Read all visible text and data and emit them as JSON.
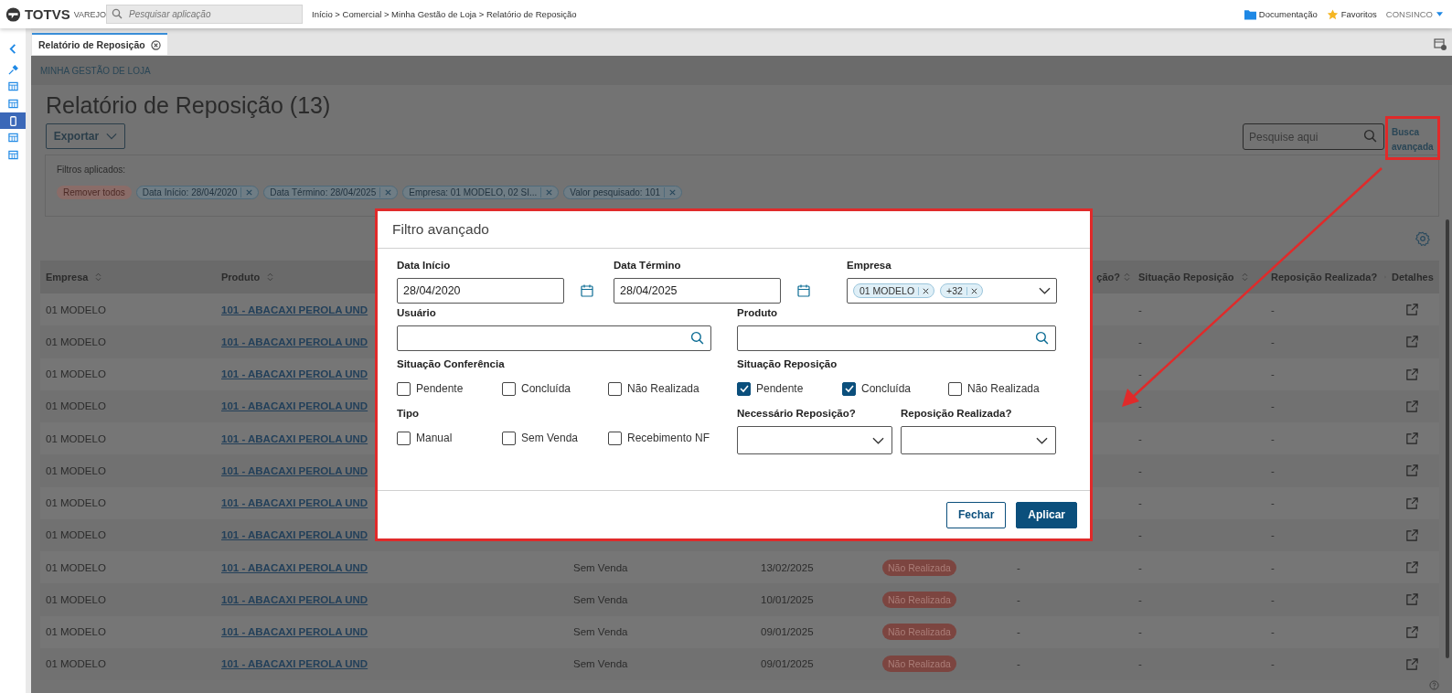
{
  "top_bar": {
    "brand": "TOTVS",
    "brand_sub": "VAREJO",
    "search": {
      "placeholder": "Pesquisar aplicação"
    },
    "breadcrumb": "Início > Comercial > Minha Gestão de Loja > Relatório de Reposição",
    "links": [
      {
        "label": "Documentação",
        "kind": "folder"
      },
      {
        "label": "Favoritos",
        "kind": "star"
      }
    ],
    "user": "CONSINCO"
  },
  "sidebar": {
    "items": [
      {
        "kind": "collapse",
        "selected": false
      },
      {
        "kind": "pin",
        "selected": false
      },
      {
        "kind": "grid",
        "selected": false
      },
      {
        "kind": "grid",
        "selected": false
      },
      {
        "kind": "phone",
        "selected": true
      },
      {
        "kind": "grid",
        "selected": false
      },
      {
        "kind": "grid",
        "selected": false
      }
    ]
  },
  "tabs": [
    {
      "label": "Relatório de Reposição",
      "selected": true
    }
  ],
  "page": {
    "section": "MINHA GESTÃO DE LOJA",
    "title": "Relatório de Reposição (13)",
    "export_button": "Exportar",
    "search": {
      "placeholder": "Pesquise aqui"
    },
    "advanced_search": "Busca avançada"
  },
  "filters": {
    "label": "Filtros aplicados:",
    "remove_all": "Remover todos",
    "chips": [
      "Data Início: 28/04/2020",
      "Data Término: 28/04/2025",
      "Empresa: 01 MODELO, 02 SI...",
      "Valor pesquisado: 101"
    ]
  },
  "table": {
    "columns": [
      {
        "label": "Empresa",
        "sortable": true
      },
      {
        "label": "Produto",
        "sortable": true
      },
      {
        "label": "ção?",
        "sortable": true
      },
      {
        "label": "Situação Reposição",
        "sortable": true
      },
      {
        "label": "Reposição Realizada?",
        "sortable": true
      },
      {
        "label": "Detalhes",
        "sortable": false
      }
    ],
    "rows": [
      {
        "empresa": "01 MODELO",
        "produto": "101 - ABACAXI PEROLA UND",
        "situacao_reposicao": "-",
        "reposicao_realizada": "-"
      },
      {
        "empresa": "01 MODELO",
        "produto": "101 - ABACAXI PEROLA UND",
        "situacao_reposicao": "-",
        "reposicao_realizada": "-"
      },
      {
        "empresa": "01 MODELO",
        "produto": "101 - ABACAXI PEROLA UND",
        "situacao_reposicao": "-",
        "reposicao_realizada": "-"
      },
      {
        "empresa": "01 MODELO",
        "produto": "101 - ABACAXI PEROLA UND",
        "situacao_reposicao": "-",
        "reposicao_realizada": "-"
      },
      {
        "empresa": "01 MODELO",
        "produto": "101 - ABACAXI PEROLA UND",
        "situacao_reposicao": "-",
        "reposicao_realizada": "-"
      },
      {
        "empresa": "01 MODELO",
        "produto": "101 - ABACAXI PEROLA UND",
        "situacao_reposicao": "-",
        "reposicao_realizada": "-"
      },
      {
        "empresa": "01 MODELO",
        "produto": "101 - ABACAXI PEROLA UND",
        "situacao_reposicao": "-",
        "reposicao_realizada": "-"
      },
      {
        "empresa": "01 MODELO",
        "produto": "101 - ABACAXI PEROLA UND",
        "situacao_reposicao": "-",
        "reposicao_realizada": "-"
      },
      {
        "empresa": "01 MODELO",
        "produto": "101 - ABACAXI PEROLA UND",
        "tipo": "Sem Venda",
        "data": "13/02/2025",
        "situacao": "Não Realizada",
        "column_6": "-",
        "situacao_reposicao": "-",
        "reposicao_realizada": "-"
      },
      {
        "empresa": "01 MODELO",
        "produto": "101 - ABACAXI PEROLA UND",
        "tipo": "Sem Venda",
        "data": "10/01/2025",
        "situacao": "Não Realizada",
        "column_6": "-",
        "situacao_reposicao": "-",
        "reposicao_realizada": "-"
      },
      {
        "empresa": "01 MODELO",
        "produto": "101 - ABACAXI PEROLA UND",
        "tipo": "Sem Venda",
        "data": "09/01/2025",
        "situacao": "Não Realizada",
        "column_6": "-",
        "situacao_reposicao": "-",
        "reposicao_realizada": "-"
      },
      {
        "empresa": "01 MODELO",
        "produto": "101 - ABACAXI PEROLA UND",
        "tipo": "Sem Venda",
        "data": "09/01/2025",
        "situacao": "Não Realizada",
        "column_6": "-",
        "situacao_reposicao": "-",
        "reposicao_realizada": "-"
      }
    ]
  },
  "modal": {
    "title": "Filtro avançado",
    "data_inicio": {
      "label": "Data Início",
      "value": "28/04/2020"
    },
    "data_termino": {
      "label": "Data Término",
      "value": "28/04/2025"
    },
    "empresa": {
      "label": "Empresa",
      "tags": [
        "01 MODELO",
        "+32"
      ]
    },
    "usuario": {
      "label": "Usuário"
    },
    "produto": {
      "label": "Produto"
    },
    "situacao_conferencia": {
      "label": "Situação Conferência",
      "options": [
        {
          "label": "Pendente",
          "checked": false
        },
        {
          "label": "Concluída",
          "checked": false
        },
        {
          "label": "Não Realizada",
          "checked": false
        }
      ]
    },
    "situacao_reposicao": {
      "label": "Situação Reposição",
      "options": [
        {
          "label": "Pendente",
          "checked": true
        },
        {
          "label": "Concluída",
          "checked": true
        },
        {
          "label": "Não Realizada",
          "checked": false
        }
      ]
    },
    "tipo": {
      "label": "Tipo",
      "options": [
        {
          "label": "Manual",
          "checked": false
        },
        {
          "label": "Sem Venda",
          "checked": false
        },
        {
          "label": "Recebimento NF",
          "checked": false
        }
      ]
    },
    "necessario_reposicao": {
      "label": "Necessário Reposição?"
    },
    "reposicao_realizada": {
      "label": "Reposição Realizada?"
    },
    "buttons": [
      {
        "label": "Fechar",
        "kind": "secondary"
      },
      {
        "label": "Aplicar",
        "kind": "primary"
      }
    ]
  }
}
